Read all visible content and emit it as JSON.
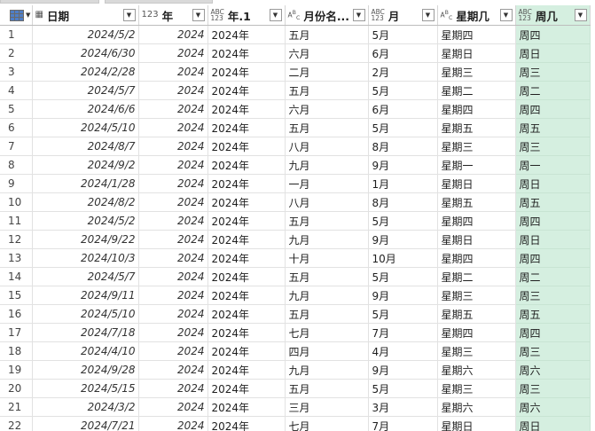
{
  "columns": [
    {
      "type_icon": "",
      "label": ""
    },
    {
      "type_icon": "calendar",
      "label": "日期"
    },
    {
      "type_icon": "123",
      "label": "年"
    },
    {
      "type_icon": "ABC 123",
      "label": "年.1"
    },
    {
      "type_icon": "ABC",
      "label": "月份名..."
    },
    {
      "type_icon": "ABC 123",
      "label": "月"
    },
    {
      "type_icon": "ABC",
      "label": "星期几"
    },
    {
      "type_icon": "ABC 123",
      "label": "周几"
    }
  ],
  "rows": [
    {
      "n": "1",
      "date": "2024/5/2",
      "year": "2024",
      "year1": "2024年",
      "month_name": "五月",
      "month": "5月",
      "weekday": "星期四",
      "week": "周四"
    },
    {
      "n": "2",
      "date": "2024/6/30",
      "year": "2024",
      "year1": "2024年",
      "month_name": "六月",
      "month": "6月",
      "weekday": "星期日",
      "week": "周日"
    },
    {
      "n": "3",
      "date": "2024/2/28",
      "year": "2024",
      "year1": "2024年",
      "month_name": "二月",
      "month": "2月",
      "weekday": "星期三",
      "week": "周三"
    },
    {
      "n": "4",
      "date": "2024/5/7",
      "year": "2024",
      "year1": "2024年",
      "month_name": "五月",
      "month": "5月",
      "weekday": "星期二",
      "week": "周二"
    },
    {
      "n": "5",
      "date": "2024/6/6",
      "year": "2024",
      "year1": "2024年",
      "month_name": "六月",
      "month": "6月",
      "weekday": "星期四",
      "week": "周四"
    },
    {
      "n": "6",
      "date": "2024/5/10",
      "year": "2024",
      "year1": "2024年",
      "month_name": "五月",
      "month": "5月",
      "weekday": "星期五",
      "week": "周五"
    },
    {
      "n": "7",
      "date": "2024/8/7",
      "year": "2024",
      "year1": "2024年",
      "month_name": "八月",
      "month": "8月",
      "weekday": "星期三",
      "week": "周三"
    },
    {
      "n": "8",
      "date": "2024/9/2",
      "year": "2024",
      "year1": "2024年",
      "month_name": "九月",
      "month": "9月",
      "weekday": "星期一",
      "week": "周一"
    },
    {
      "n": "9",
      "date": "2024/1/28",
      "year": "2024",
      "year1": "2024年",
      "month_name": "一月",
      "month": "1月",
      "weekday": "星期日",
      "week": "周日"
    },
    {
      "n": "10",
      "date": "2024/8/2",
      "year": "2024",
      "year1": "2024年",
      "month_name": "八月",
      "month": "8月",
      "weekday": "星期五",
      "week": "周五"
    },
    {
      "n": "11",
      "date": "2024/5/2",
      "year": "2024",
      "year1": "2024年",
      "month_name": "五月",
      "month": "5月",
      "weekday": "星期四",
      "week": "周四"
    },
    {
      "n": "12",
      "date": "2024/9/22",
      "year": "2024",
      "year1": "2024年",
      "month_name": "九月",
      "month": "9月",
      "weekday": "星期日",
      "week": "周日"
    },
    {
      "n": "13",
      "date": "2024/10/3",
      "year": "2024",
      "year1": "2024年",
      "month_name": "十月",
      "month": "10月",
      "weekday": "星期四",
      "week": "周四"
    },
    {
      "n": "14",
      "date": "2024/5/7",
      "year": "2024",
      "year1": "2024年",
      "month_name": "五月",
      "month": "5月",
      "weekday": "星期二",
      "week": "周二"
    },
    {
      "n": "15",
      "date": "2024/9/11",
      "year": "2024",
      "year1": "2024年",
      "month_name": "九月",
      "month": "9月",
      "weekday": "星期三",
      "week": "周三"
    },
    {
      "n": "16",
      "date": "2024/5/10",
      "year": "2024",
      "year1": "2024年",
      "month_name": "五月",
      "month": "5月",
      "weekday": "星期五",
      "week": "周五"
    },
    {
      "n": "17",
      "date": "2024/7/18",
      "year": "2024",
      "year1": "2024年",
      "month_name": "七月",
      "month": "7月",
      "weekday": "星期四",
      "week": "周四"
    },
    {
      "n": "18",
      "date": "2024/4/10",
      "year": "2024",
      "year1": "2024年",
      "month_name": "四月",
      "month": "4月",
      "weekday": "星期三",
      "week": "周三"
    },
    {
      "n": "19",
      "date": "2024/9/28",
      "year": "2024",
      "year1": "2024年",
      "month_name": "九月",
      "month": "9月",
      "weekday": "星期六",
      "week": "周六"
    },
    {
      "n": "20",
      "date": "2024/5/15",
      "year": "2024",
      "year1": "2024年",
      "month_name": "五月",
      "month": "5月",
      "weekday": "星期三",
      "week": "周三"
    },
    {
      "n": "21",
      "date": "2024/3/2",
      "year": "2024",
      "year1": "2024年",
      "month_name": "三月",
      "month": "3月",
      "weekday": "星期六",
      "week": "周六"
    },
    {
      "n": "22",
      "date": "2024/7/21",
      "year": "2024",
      "year1": "2024年",
      "month_name": "七月",
      "month": "7月",
      "weekday": "星期日",
      "week": "周日"
    }
  ],
  "colors": {
    "selected_column": "#d5efe0",
    "grid": "#e2e2e2",
    "header_border": "#bdbdbd"
  },
  "icons": {
    "table_corner": "table-icon",
    "dropdown": "chevron-down-icon",
    "calendar": "calendar-icon"
  }
}
